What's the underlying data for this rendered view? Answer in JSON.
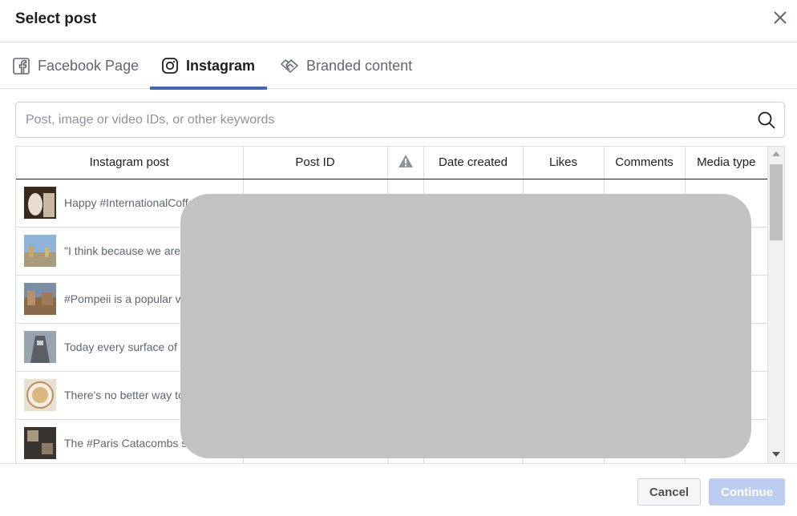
{
  "dialog": {
    "title": "Select post"
  },
  "tabs": [
    {
      "label": "Facebook Page",
      "icon": "facebook-icon"
    },
    {
      "label": "Instagram",
      "icon": "instagram-icon",
      "active": true
    },
    {
      "label": "Branded content",
      "icon": "handshake-icon"
    }
  ],
  "search": {
    "placeholder": "Post, image or video IDs, or other keywords",
    "value": ""
  },
  "table": {
    "columns": [
      "Instagram post",
      "Post ID",
      "",
      "Date created",
      "Likes",
      "Comments",
      "Media type"
    ],
    "rows": [
      {
        "text": "Happy #InternationalCoffe",
        "thumb_colors": [
          "#3a2a1e",
          "#c9b8a3"
        ]
      },
      {
        "text": "\"I think because we are",
        "thumb_colors": [
          "#8fb3d9",
          "#a89a7c"
        ]
      },
      {
        "text": "#Pompeii is a popular vi",
        "thumb_colors": [
          "#7a8ea5",
          "#8a6a4a"
        ]
      },
      {
        "text": "Today every surface of t",
        "thumb_colors": [
          "#9aa3b0",
          "#5a5f66"
        ]
      },
      {
        "text": "There's no better way to",
        "thumb_colors": [
          "#e8e0d0",
          "#c8a070"
        ]
      },
      {
        "text": "The #Paris Catacombs s",
        "thumb_colors": [
          "#3a3430",
          "#a89880"
        ]
      }
    ]
  },
  "footer": {
    "cancel_label": "Cancel",
    "continue_label": "Continue"
  },
  "colors": {
    "accent": "#4267b2",
    "continue_disabled": "#bccdf1",
    "redaction": "#c2c2c2"
  }
}
